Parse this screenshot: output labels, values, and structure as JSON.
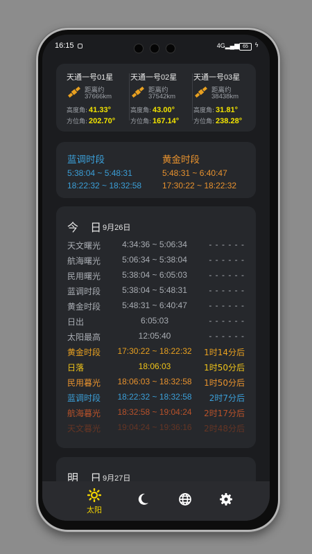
{
  "status": {
    "time": "16:15",
    "signal": "4G",
    "battery": "65"
  },
  "satellites": [
    {
      "name": "天通一号01星",
      "dist_label": "距离约",
      "distance": "37666km",
      "elev_label": "高度角:",
      "elevation": "41.33°",
      "azim_label": "方位角:",
      "azimuth": "202.70°"
    },
    {
      "name": "天通一号02星",
      "dist_label": "距离约",
      "distance": "37542km",
      "elev_label": "高度角:",
      "elevation": "43.00°",
      "azim_label": "方位角:",
      "azimuth": "167.14°"
    },
    {
      "name": "天通一号03星",
      "dist_label": "距离约",
      "distance": "38438km",
      "elev_label": "高度角:",
      "elevation": "31.81°",
      "azim_label": "方位角:",
      "azimuth": "238.28°"
    }
  ],
  "blue_hour": {
    "title": "蓝调时段",
    "morning": "5:38:04 ~ 5:48:31",
    "evening": "18:22:32 ~ 18:32:58"
  },
  "golden_hour": {
    "title": "黄金时段",
    "morning": "5:48:31 ~ 6:40:47",
    "evening": "17:30:22 ~ 18:22:32"
  },
  "today": {
    "label": "今 日",
    "date": "9月26日",
    "events": [
      {
        "name": "天文曙光",
        "time": "4:34:36 ~ 5:06:34",
        "rel": "- - - - - -"
      },
      {
        "name": "航海曙光",
        "time": "5:06:34 ~ 5:38:04",
        "rel": "- - - - - -"
      },
      {
        "name": "民用曙光",
        "time": "5:38:04 ~ 6:05:03",
        "rel": "- - - - - -"
      },
      {
        "name": "蓝调时段",
        "time": "5:38:04 ~ 5:48:31",
        "rel": "- - - - - -"
      },
      {
        "name": "黄金时段",
        "time": "5:48:31 ~ 6:40:47",
        "rel": "- - - - - -"
      },
      {
        "name": "日出",
        "time": "6:05:03",
        "rel": "- - - - - -"
      },
      {
        "name": "太阳最高",
        "time": "12:05:40",
        "rel": "- - - - - -"
      },
      {
        "name": "黄金时段",
        "time": "17:30:22 ~ 18:22:32",
        "rel": "1时14分后"
      },
      {
        "name": "日落",
        "time": "18:06:03",
        "rel": "1时50分后"
      },
      {
        "name": "民用暮光",
        "time": "18:06:03 ~ 18:32:58",
        "rel": "1时50分后"
      },
      {
        "name": "蓝调时段",
        "time": "18:22:32 ~ 18:32:58",
        "rel": "2时7分后"
      },
      {
        "name": "航海暮光",
        "time": "18:32:58 ~ 19:04:24",
        "rel": "2时17分后"
      },
      {
        "name": "天文暮光",
        "time": "19:04:24 ~ 19:36:16",
        "rel": "2时48分后"
      }
    ]
  },
  "tomorrow": {
    "label": "明 日",
    "date": "9月27日"
  },
  "nav": {
    "sun_label": "太阳",
    "sun_icon": "sun-icon",
    "moon_icon": "moon-icon",
    "globe_icon": "globe-icon",
    "settings_icon": "gear-icon",
    "active_color": "#f2d300"
  },
  "colors": {
    "past": "#a9adb3",
    "gold": "#e8a020",
    "sunset": "#f0c419",
    "civil": "#e8922e",
    "blue": "#3b9fd8",
    "nautical": "#b8522a",
    "astronomical": "#7a3a22"
  }
}
